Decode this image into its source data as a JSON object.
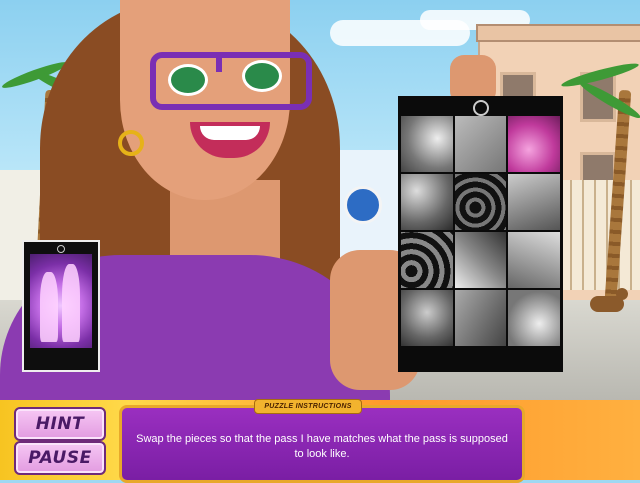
{
  "buttons": {
    "hint": "HINT",
    "pause": "PAUSE"
  },
  "instructions": {
    "title": "PUZZLE INSTRUCTIONS",
    "text": "Swap the pieces so that the pass I have matches what the pass is supposed to look like."
  },
  "colors": {
    "button_fill": "#e9a7e6",
    "panel": "#8a29b4",
    "bar_yellow": "#f7c421",
    "bar_orange": "#ff9a2a"
  },
  "puzzle": {
    "rows": 4,
    "cols": 3
  }
}
